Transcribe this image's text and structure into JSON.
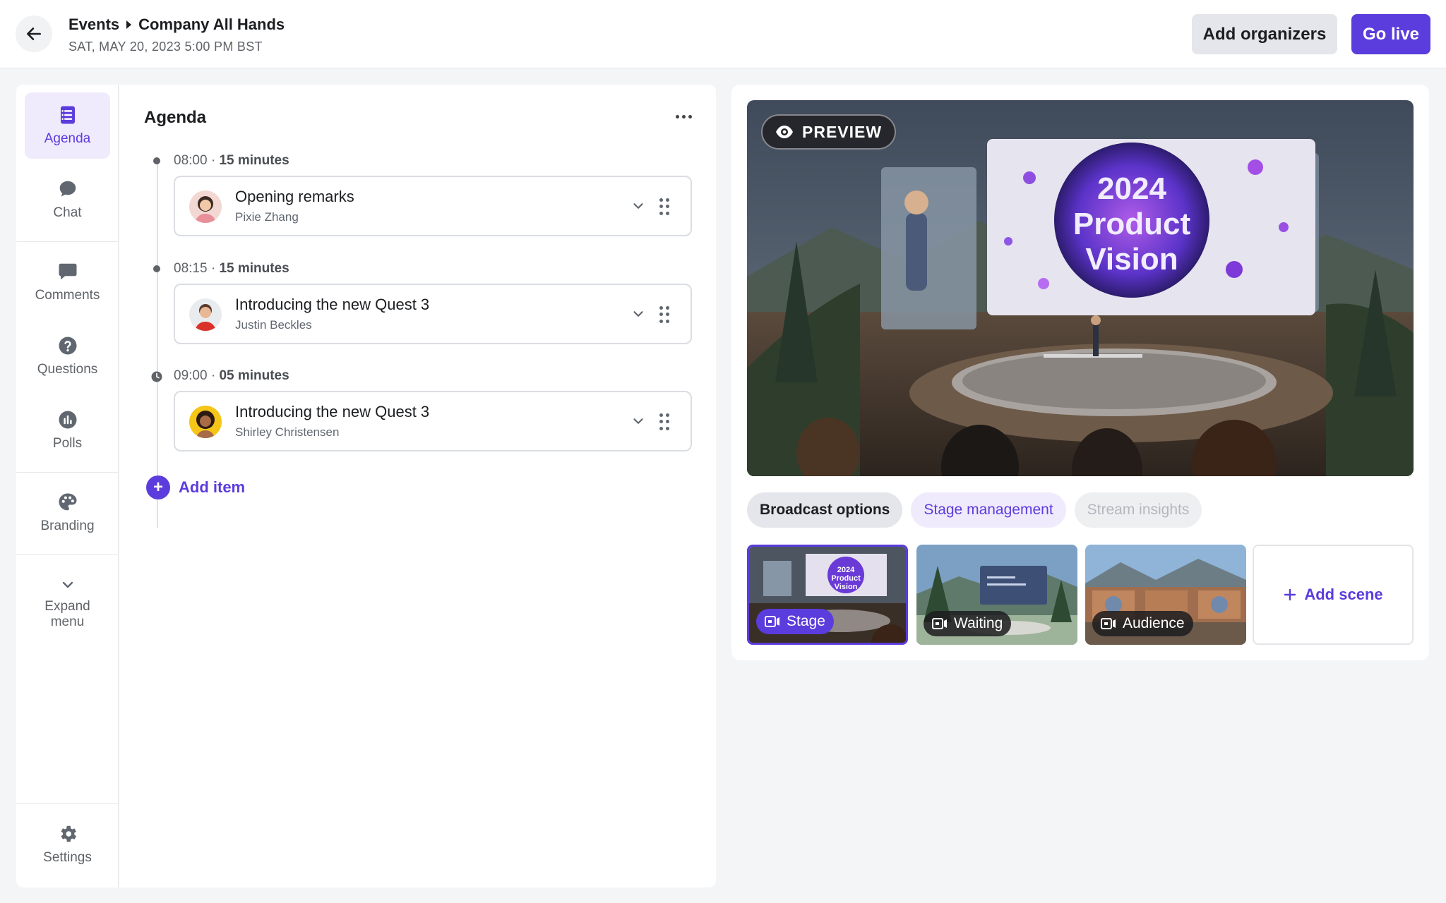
{
  "header": {
    "breadcrumb": [
      "Events",
      "Company All Hands"
    ],
    "date": "SAT, MAY 20, 2023 5:00 PM BST",
    "add_organizers": "Add organizers",
    "go_live": "Go live"
  },
  "rail": {
    "items": [
      {
        "label": "Agenda",
        "icon": "agenda-icon"
      },
      {
        "label": "Chat",
        "icon": "chat-icon"
      },
      {
        "label": "Comments",
        "icon": "comments-icon"
      },
      {
        "label": "Questions",
        "icon": "question-icon"
      },
      {
        "label": "Polls",
        "icon": "polls-icon"
      },
      {
        "label": "Branding",
        "icon": "palette-icon"
      },
      {
        "label": "Expand menu",
        "icon": "chevron-down-icon"
      },
      {
        "label": "Settings",
        "icon": "gear-icon"
      }
    ]
  },
  "agenda": {
    "title": "Agenda",
    "items": [
      {
        "time": "08:00",
        "duration": "15 minutes",
        "title": "Opening remarks",
        "speaker": "Pixie Zhang"
      },
      {
        "time": "08:15",
        "duration": "15 minutes",
        "title": "Introducing the new Quest 3",
        "speaker": "Justin Beckles"
      },
      {
        "time": "09:00",
        "duration": "05 minutes",
        "title": "Introducing the new Quest 3",
        "speaker": "Shirley Christensen"
      }
    ],
    "add_item": "Add item"
  },
  "preview": {
    "badge": "PREVIEW",
    "screen_text": [
      "2024",
      "Product",
      "Vision"
    ]
  },
  "tabs": [
    "Broadcast options",
    "Stage management",
    "Stream insights"
  ],
  "scenes": {
    "items": [
      "Stage",
      "Waiting",
      "Audience"
    ],
    "add_label": "Add scene"
  },
  "colors": {
    "accent": "#5b3cdc",
    "accent_light": "#efebfc"
  }
}
